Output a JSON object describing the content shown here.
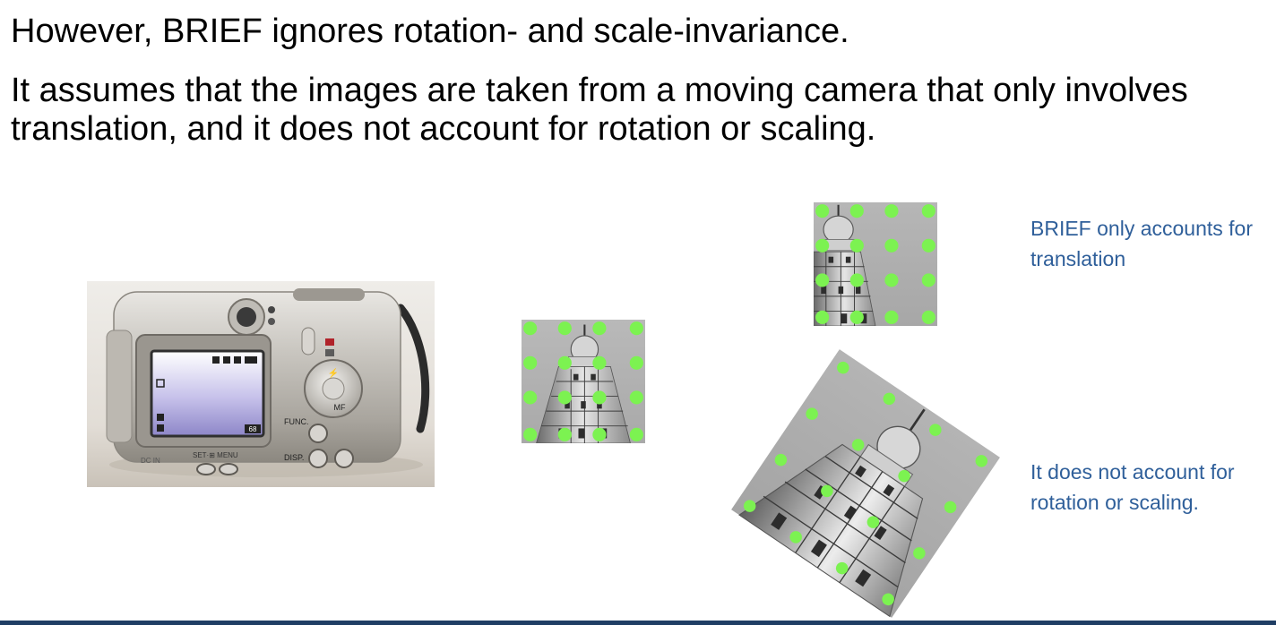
{
  "slide": {
    "heading_1": "However, BRIEF ignores rotation- and scale-invariance.",
    "heading_2": "It assumes that the images are taken from a moving camera that only involves translation, and it does not account for rotation or scaling.",
    "note_translation": "BRIEF only accounts for translation",
    "note_rotation": "It does not account for rotation or scaling."
  },
  "camera_labels": {
    "dc_in": "DC IN",
    "set_menu": "SET·⊞ MENU",
    "func": "FUNC.",
    "disp": "DISP.",
    "mf": "MF",
    "shots": "68"
  },
  "colors": {
    "heading_text": "#000000",
    "note_text": "#2f5f9a",
    "sample_point": "#7cf251",
    "bottom_rule": "#1f3e64"
  }
}
